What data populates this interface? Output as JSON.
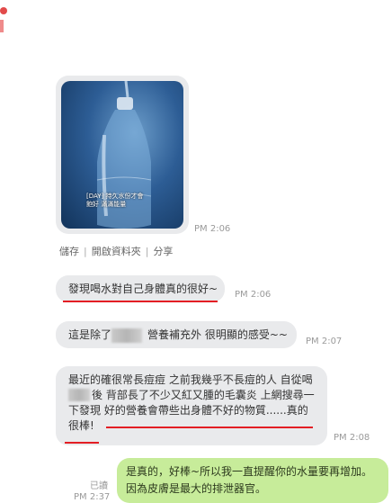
{
  "image_message": {
    "caption": "[DAY] 持久水份才會飽好 滿滿能量",
    "time": "PM 2:06",
    "actions": [
      "儲存",
      "開啟資料夾",
      "分享"
    ]
  },
  "messages": [
    {
      "text": "發現喝水對自己身體真的很好~",
      "time": "PM 2:06"
    },
    {
      "text_before": "這是除了",
      "text_after": "營養補充外  很明顯的感受~~",
      "time": "PM 2:07"
    },
    {
      "line1": "最近的確很常長痘痘 之前我幾乎不長痘的人 自從喝",
      "line2_after": "後 背部長了不少又紅又腫的毛囊炎  上網搜尋一",
      "line3": "下發現 好的營養會帶些出身體不好的物質......真的",
      "line4": "很棒!",
      "time": "PM 2:08"
    }
  ],
  "outgoing": {
    "line1": "是真的，好棒~所以我一直提醒你的水量要再增加。",
    "line2": "因為皮膚是最大的排泄器官。",
    "read_label": "已讀",
    "time": "PM 2:37"
  },
  "colors": {
    "incoming_bubble": "#e9eaec",
    "outgoing_bubble": "#c7ec9a",
    "underline": "#e31e24"
  }
}
